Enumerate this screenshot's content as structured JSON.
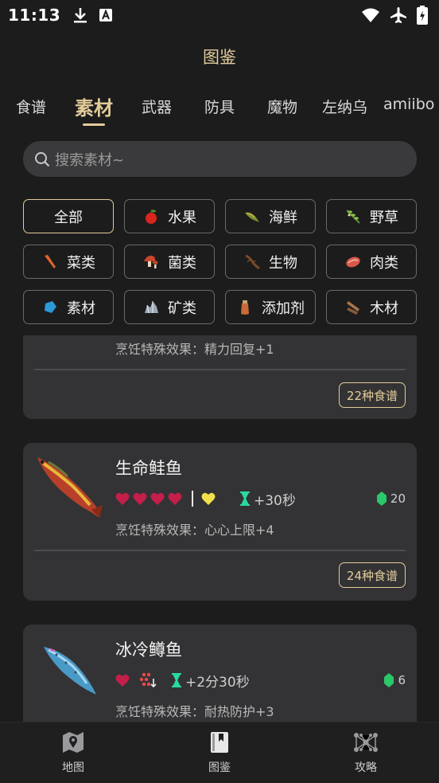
{
  "status": {
    "time": "11:13"
  },
  "header": {
    "title": "图鉴"
  },
  "tabs": [
    {
      "label": "食谱"
    },
    {
      "label": "素材"
    },
    {
      "label": "武器"
    },
    {
      "label": "防具"
    },
    {
      "label": "魔物"
    },
    {
      "label": "左纳乌"
    },
    {
      "label": "amiibo"
    }
  ],
  "active_tab": "素材",
  "search": {
    "placeholder": "搜索素材~",
    "value": ""
  },
  "filters": [
    {
      "label": "全部",
      "icon": "none",
      "active": true
    },
    {
      "label": "水果",
      "icon": "apple-icon"
    },
    {
      "label": "海鲜",
      "icon": "fish-icon"
    },
    {
      "label": "野草",
      "icon": "herb-icon"
    },
    {
      "label": "菜类",
      "icon": "carrot-icon"
    },
    {
      "label": "菌类",
      "icon": "mushroom-icon"
    },
    {
      "label": "生物",
      "icon": "lizard-icon"
    },
    {
      "label": "肉类",
      "icon": "meat-icon"
    },
    {
      "label": "素材",
      "icon": "crystal-icon"
    },
    {
      "label": "矿类",
      "icon": "ore-icon"
    },
    {
      "label": "添加剂",
      "icon": "bottle-icon"
    },
    {
      "label": "木材",
      "icon": "wood-icon"
    }
  ],
  "items": [
    {
      "effect": "烹饪特殊效果：精力回复+1",
      "recipes": "22种食谱"
    },
    {
      "name": "生命鲑鱼",
      "hearts": 4,
      "extra_icon": "golden-heart-icon",
      "duration": "+30秒",
      "value": "20",
      "effect": "烹饪特殊效果：心心上限+4",
      "recipes": "24种食谱"
    },
    {
      "name": "冰冷鳟鱼",
      "hearts": 1,
      "extra_icon": "cold-resist-icon",
      "duration": "+2分30秒",
      "value": "6",
      "effect": "烹饪特殊效果：耐热防护+3"
    }
  ],
  "nav": [
    {
      "label": "地图",
      "icon": "map-icon"
    },
    {
      "label": "图鉴",
      "icon": "book-icon"
    },
    {
      "label": "攻略",
      "icon": "network-icon"
    }
  ],
  "colors": {
    "accent": "#e2cc9a",
    "heart": "#c41e4a",
    "background": "#1c1c1d",
    "card": "#333335"
  }
}
